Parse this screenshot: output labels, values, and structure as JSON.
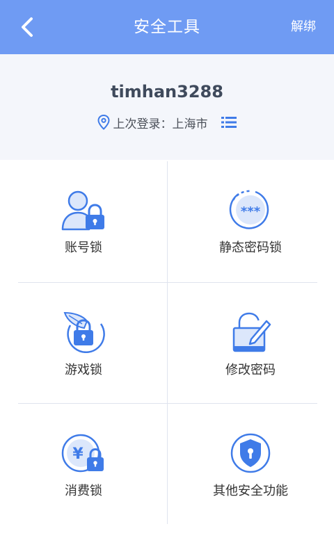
{
  "header": {
    "title": "安全工具",
    "unbind_label": "解绑"
  },
  "account": {
    "username": "timhan3288",
    "last_login": "上次登录：上海市"
  },
  "tools": [
    {
      "label": "账号锁",
      "icon": "account-lock-icon"
    },
    {
      "label": "静态密码锁",
      "icon": "static-password-icon"
    },
    {
      "label": "游戏锁",
      "icon": "game-lock-icon"
    },
    {
      "label": "修改密码",
      "icon": "edit-password-icon"
    },
    {
      "label": "消费锁",
      "icon": "payment-lock-icon"
    },
    {
      "label": "其他安全功能",
      "icon": "shield-icon"
    }
  ],
  "colors": {
    "primary": "#6f9bf3",
    "icon_blue": "#3f7be8",
    "icon_light": "#dce7fb"
  }
}
